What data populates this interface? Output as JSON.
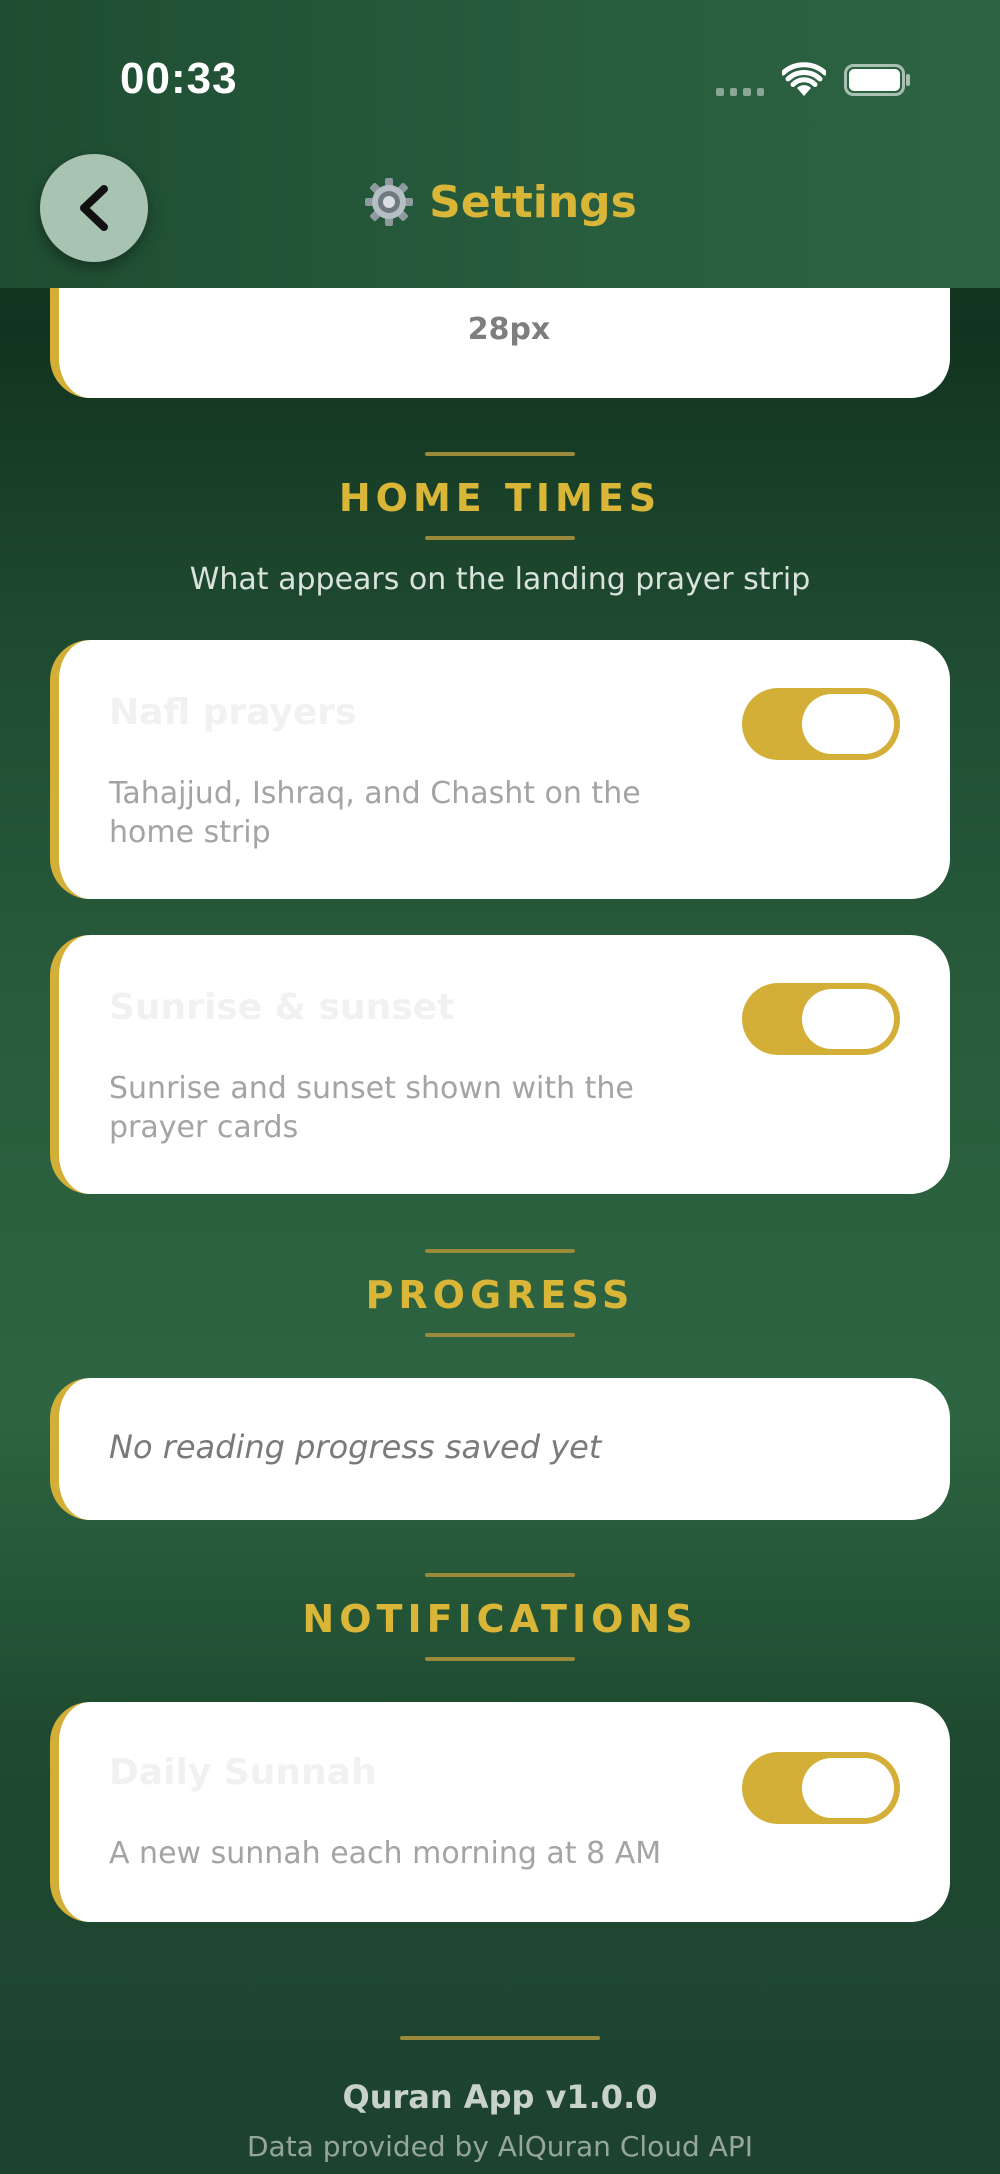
{
  "status_bar": {
    "time": "00:33",
    "icons": [
      "signal-icon",
      "wifi-icon",
      "battery-icon"
    ]
  },
  "header": {
    "back_icon": "chevron-left-icon",
    "title_icon": "gear-icon",
    "title": "Settings"
  },
  "font_size_card": {
    "value": "28px"
  },
  "home_times": {
    "heading": "HOME TIMES",
    "subtitle": "What appears on the landing prayer strip",
    "items": [
      {
        "title": "Nafl prayers",
        "description": "Tahajjud, Ishraq, and Chasht on the home strip",
        "enabled": true
      },
      {
        "title": "Sunrise & sunset",
        "description": "Sunrise and sunset shown with the prayer cards",
        "enabled": true
      }
    ]
  },
  "progress": {
    "heading": "PROGRESS",
    "empty_message": "No reading progress saved yet"
  },
  "notifications": {
    "heading": "NOTIFICATIONS",
    "items": [
      {
        "title": "Daily Sunnah",
        "description": "A new sunnah each morning at 8 AM",
        "enabled": true
      }
    ]
  },
  "footer": {
    "version": "Quran App v1.0.0",
    "credit": "Data provided by AlQuran Cloud API"
  },
  "colors": {
    "accent_gold": "#d4af37",
    "title_gold": "#d9b637",
    "bg_green": "#1e4a30",
    "card_bg": "#ffffff"
  }
}
